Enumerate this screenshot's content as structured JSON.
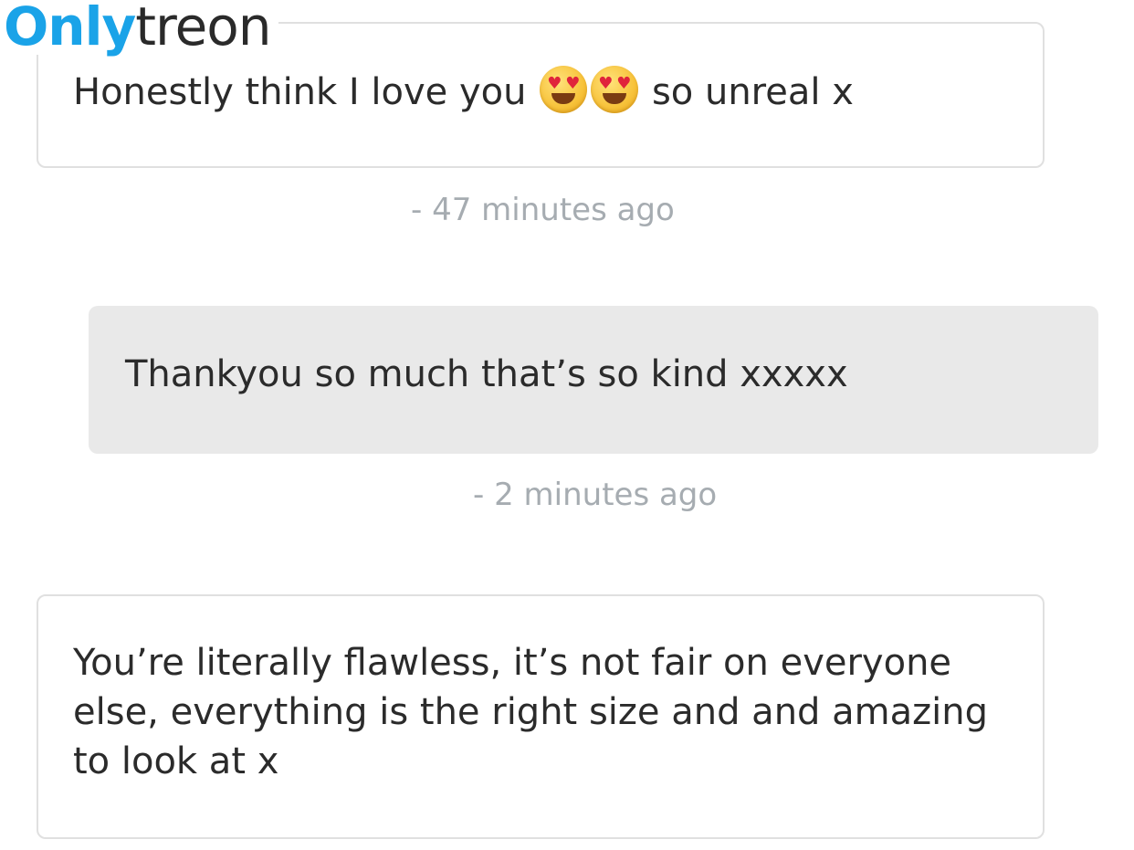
{
  "watermark": {
    "part1": "Only",
    "part2": "treon"
  },
  "messages": [
    {
      "direction": "incoming",
      "text_before": "Honestly think I love you",
      "emojis": [
        "heart-eyes-emoji",
        "heart-eyes-emoji"
      ],
      "text_after": "so unreal x",
      "timestamp": "47 minutes ago"
    },
    {
      "direction": "outgoing",
      "text": "Thankyou so much that’s so kind xxxxx",
      "timestamp": "2 minutes ago"
    },
    {
      "direction": "incoming",
      "text": "You’re literally flawless, it’s not fair on everyone else, everything is the right size and and amazing to look at x"
    }
  ],
  "timestamp_prefix": "-",
  "colors": {
    "incoming_bg": "#ffffff",
    "incoming_border": "#e0e0e0",
    "outgoing_bg": "#e9e9e9",
    "timestamp": "#a6acb1",
    "watermark_accent": "#1aa3e8"
  }
}
